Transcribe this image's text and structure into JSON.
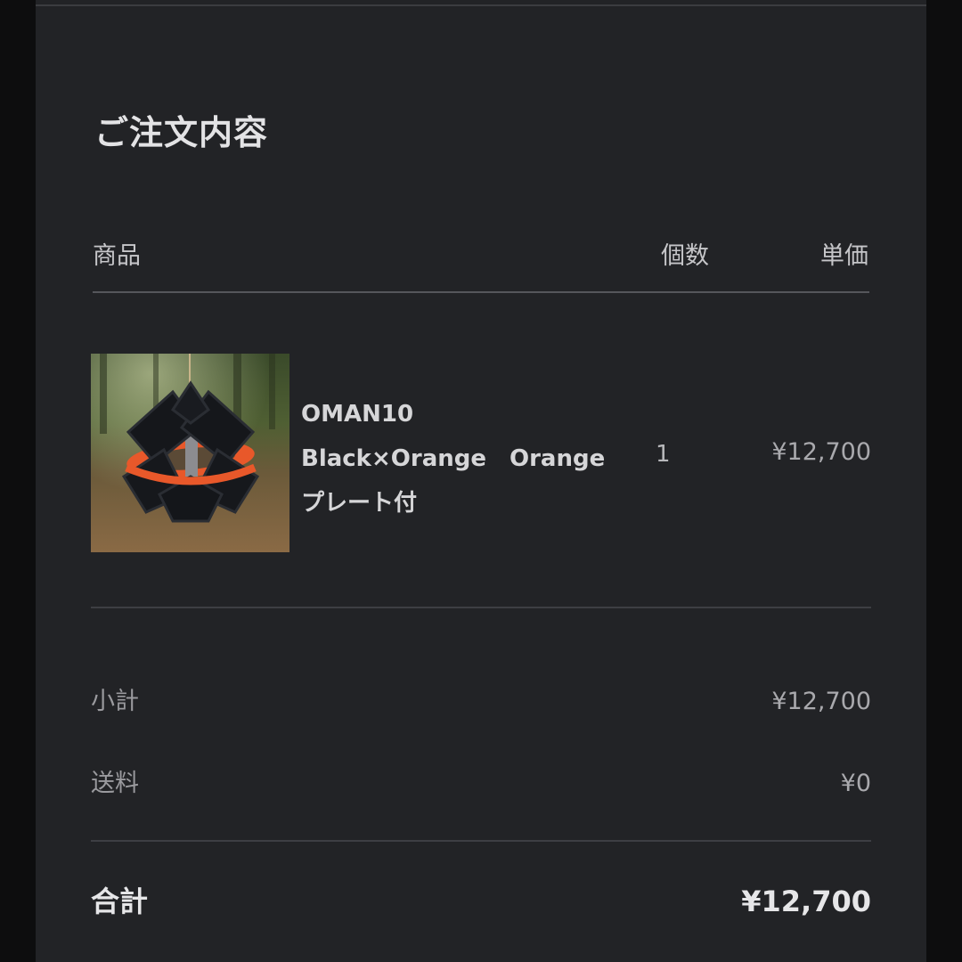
{
  "order": {
    "title": "ご注文内容",
    "columns": {
      "product": "商品",
      "quantity": "個数",
      "unit_price": "単価"
    },
    "items": [
      {
        "name_lines": [
          "OMAN10",
          "Black×Orange　Orange",
          "プレート付"
        ],
        "quantity": "1",
        "unit_price": "¥12,700",
        "image": "product-lantern-shade-photo"
      }
    ],
    "summary": {
      "subtotal_label": "小計",
      "subtotal_value": "¥12,700",
      "shipping_label": "送料",
      "shipping_value": "¥0",
      "total_label": "合計",
      "total_value": "¥12,700"
    }
  },
  "colors": {
    "background": "#0d0d0e",
    "panel": "#222326",
    "accent_orange": "#e8582a"
  }
}
